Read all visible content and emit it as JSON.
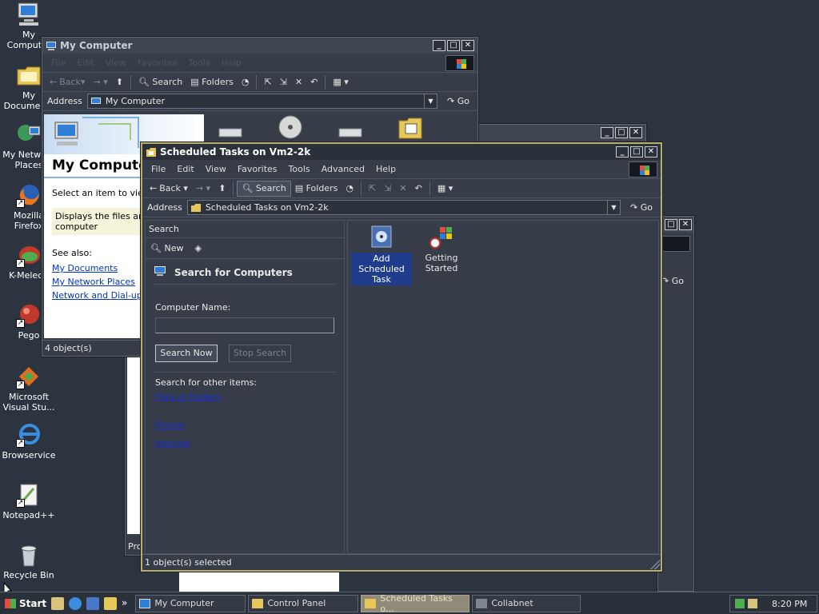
{
  "desktop": {
    "icons": [
      {
        "label": "My Computer",
        "icon": "computer-icon"
      },
      {
        "label": "My Documents",
        "icon": "folder-icon"
      },
      {
        "label": "My Network Places",
        "icon": "network-icon"
      },
      {
        "label": "Mozilla Firefox",
        "icon": "firefox-icon"
      },
      {
        "label": "K-Meleon",
        "icon": "kmeleon-icon"
      },
      {
        "label": "Pego",
        "icon": "app-icon"
      },
      {
        "label": "Microsoft Visual Stu...",
        "icon": "visual-studio-icon"
      },
      {
        "label": "Browservice",
        "icon": "browser-icon"
      },
      {
        "label": "Notepad++",
        "icon": "notepad-icon"
      },
      {
        "label": "Recycle Bin",
        "icon": "recycle-bin-icon"
      }
    ]
  },
  "my_computer_window": {
    "title": "My Computer",
    "menu": [
      "File",
      "Edit",
      "View",
      "Favorites",
      "Tools",
      "Help"
    ],
    "toolbar": {
      "back": "Back",
      "search": "Search",
      "folders": "Folders"
    },
    "address_label": "Address",
    "address_value": "My Computer",
    "go": "Go",
    "panel_title": "My Computer",
    "panel_text1": "Select an item to view i",
    "panel_text2": "Displays the files and fo",
    "panel_text3": "computer",
    "see_also": "See also:",
    "links": [
      "My Documents",
      "My Network Places",
      "Network and Dial-up Co"
    ],
    "status": "4 object(s)"
  },
  "control_panel_window": {
    "status_fragment": "Pro",
    "go": "Go"
  },
  "scheduled_window": {
    "title": "Scheduled Tasks on Vm2-2k",
    "menu": [
      "File",
      "Edit",
      "View",
      "Favorites",
      "Tools",
      "Advanced",
      "Help"
    ],
    "toolbar": {
      "back": "Back",
      "search": "Search",
      "folders": "Folders"
    },
    "address_label": "Address",
    "address_value": "Scheduled Tasks on Vm2-2k",
    "go": "Go",
    "search_pane": {
      "header": "Search",
      "new_label": "New",
      "title": "Search for Computers",
      "computer_name_label": "Computer Name:",
      "computer_name_value": "",
      "search_now": "Search Now",
      "stop_search": "Stop Search",
      "other_items_label": "Search for other items:",
      "other_links": [
        "Files or Folders",
        "People",
        "Internet"
      ]
    },
    "items": [
      {
        "label": "Add Scheduled Task",
        "selected": true,
        "icon": "add-task-icon"
      },
      {
        "label": "Getting Started",
        "selected": false,
        "icon": "getting-started-icon"
      }
    ],
    "status": "1 object(s) selected"
  },
  "taskbar": {
    "start_label": "Start",
    "quick_launch_more": "»",
    "tasks": [
      {
        "label": "My Computer",
        "active": false
      },
      {
        "label": "Control Panel",
        "active": false
      },
      {
        "label": "Scheduled Tasks o...",
        "active": true
      },
      {
        "label": "Collabnet",
        "active": false
      }
    ],
    "clock": "8:20 PM"
  },
  "colors": {
    "desktop": "#2c3440",
    "window_bg": "#363d48",
    "active_border": "#b8ae6a",
    "link": "#5a9aff",
    "selection": "#1f3d8c"
  }
}
